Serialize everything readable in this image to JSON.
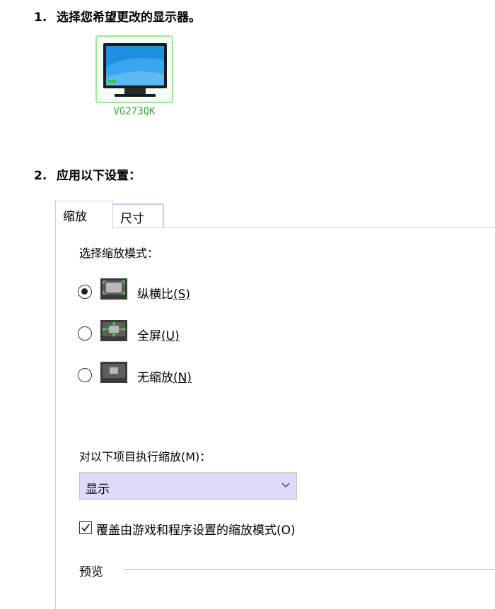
{
  "steps": {
    "select_monitor": {
      "number": "1.",
      "text": "选择您希望更改的显示器。"
    },
    "apply_settings": {
      "number": "2.",
      "text": "应用以下设置："
    }
  },
  "monitor": {
    "name": "VG273QK",
    "icon": "monitor-icon"
  },
  "tabs": [
    {
      "label": "缩放",
      "selected": true
    },
    {
      "label": "尺寸",
      "selected": false
    }
  ],
  "scaling": {
    "mode_label": "选择缩放模式：",
    "options": [
      {
        "label": "纵横比",
        "accelerator": "(S)",
        "icon": "aspect-ratio-icon",
        "selected": true
      },
      {
        "label": "全屏",
        "accelerator": "(U)",
        "icon": "full-screen-icon",
        "selected": false
      },
      {
        "label": "无缩放",
        "accelerator": "(N)",
        "icon": "no-scaling-icon",
        "selected": false
      }
    ],
    "perform_label": "对以下项目执行缩放(M)：",
    "perform_value": "显示",
    "override_label": "覆盖由游戏和程序设置的缩放模式(O)",
    "override_checked": true
  },
  "preview": {
    "label": "预览"
  },
  "colors": {
    "selection_green": "#9ee29e",
    "monitor_name": "#2eaa2e",
    "select_bg": "#dcdcfa"
  }
}
